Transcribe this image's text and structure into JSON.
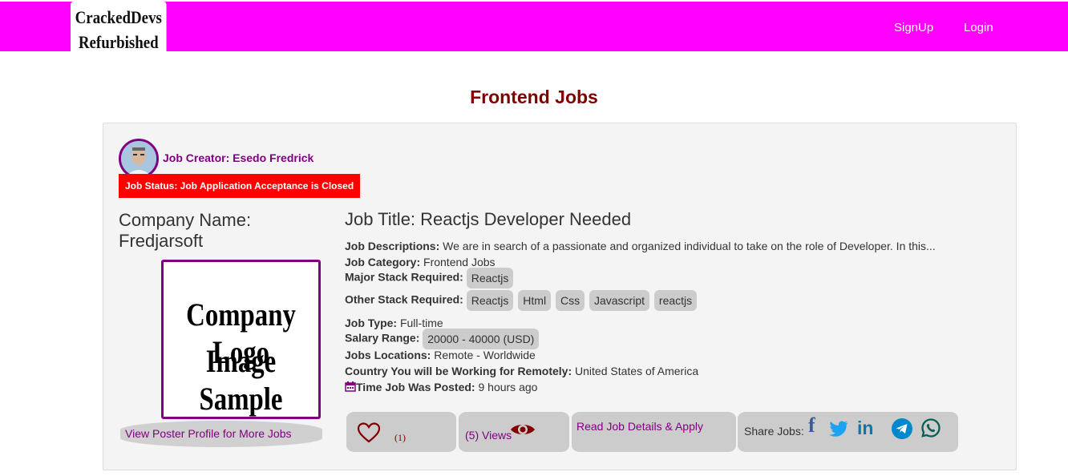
{
  "header": {
    "brand_line1": "CrackedDevs",
    "brand_line2": "Refurbished",
    "signup": "SignUp",
    "login": "Login",
    "bg_color": "#ff00ff"
  },
  "page": {
    "title": "Frontend Jobs"
  },
  "job": {
    "creator": "Job Creator: Esedo Fredrick",
    "status": "Job Status: Job Application Acceptance is Closed",
    "company_name": "Company Name: Fredjarsoft",
    "logo_line1": "Company Logo",
    "logo_line2": "Image Sample",
    "view_profile": "View Poster Profile for More Jobs",
    "title": "Job Title: Reactjs Developer Needed",
    "descriptions_label": "Job Descriptions:",
    "descriptions": "We are in search of a passionate and organized individual to take on the role of Developer. In this...",
    "category_label": "Job Category:",
    "category": "Frontend Jobs",
    "major_label": "Major Stack Required:",
    "major_stack": [
      "Reactjs"
    ],
    "other_label": "Other Stack Required:",
    "other_stack": [
      "Reactjs",
      "Html",
      "Css",
      "Javascript",
      "reactjs"
    ],
    "type_label": "Job Type:",
    "type": "Full-time",
    "salary_label": "Salary Range:",
    "salary": "20000 - 40000 (USD)",
    "location_label": "Jobs Locations:",
    "location": "Remote - Worldwide",
    "country_label": "Country You will be Working for Remotely:",
    "country": "United States of America",
    "posted_label": "Time Job Was Posted:",
    "posted": "9 hours ago",
    "likes": "(1)",
    "views": "(5) Views",
    "read_apply": "Read Job Details & Apply",
    "share_label": "Share Jobs:"
  },
  "icons": [
    "heart-icon",
    "eye-icon",
    "calendar-icon",
    "facebook-icon",
    "twitter-icon",
    "linkedin-icon",
    "telegram-icon",
    "whatsapp-icon"
  ],
  "colors": {
    "accent": "#800080",
    "title": "#800000",
    "status": "#ff0000"
  }
}
